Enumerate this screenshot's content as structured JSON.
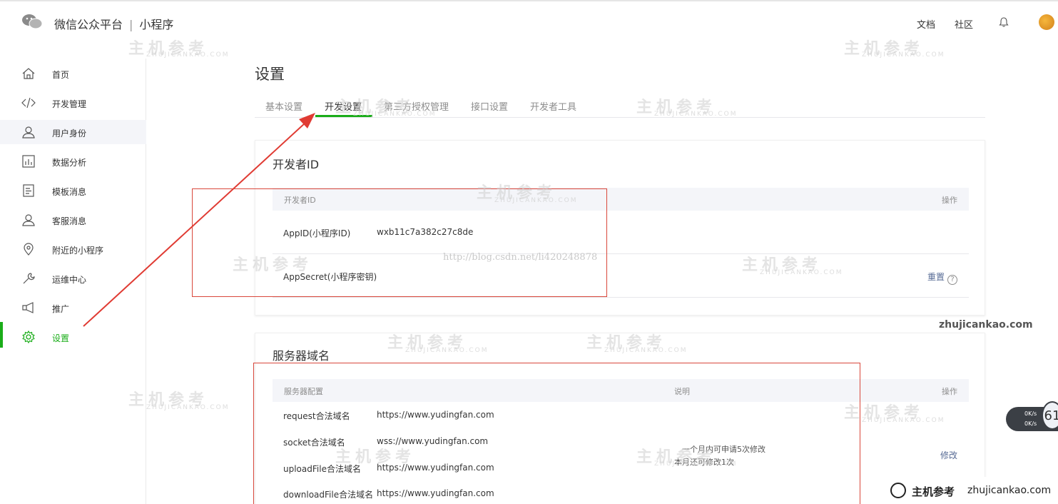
{
  "topbar": {
    "title": "微信公众平台",
    "separator": "|",
    "subtitle": "小程序",
    "links": [
      "文档",
      "社区"
    ]
  },
  "sidebar": {
    "items": [
      {
        "label": "首页",
        "icon": "home-icon"
      },
      {
        "label": "开发管理",
        "icon": "code-icon"
      },
      {
        "label": "用户身份",
        "icon": "user-icon"
      },
      {
        "label": "数据分析",
        "icon": "chart-icon"
      },
      {
        "label": "模板消息",
        "icon": "template-icon"
      },
      {
        "label": "客服消息",
        "icon": "support-icon"
      },
      {
        "label": "附近的小程序",
        "icon": "location-icon"
      },
      {
        "label": "运维中心",
        "icon": "wrench-icon"
      },
      {
        "label": "推广",
        "icon": "megaphone-icon"
      },
      {
        "label": "设置",
        "icon": "gear-icon"
      }
    ],
    "active_item": "设置"
  },
  "main": {
    "title": "设置",
    "tabs": [
      "基本设置",
      "开发设置",
      "第三方授权管理",
      "接口设置",
      "开发者工具"
    ],
    "active_tab": "开发设置",
    "developer_id": {
      "title": "开发者ID",
      "header": {
        "col1": "开发者ID",
        "col2": "操作"
      },
      "rows": [
        {
          "label": "AppID(小程序ID)",
          "value": "wxb11c7a382c27c8de",
          "action": ""
        },
        {
          "label": "AppSecret(小程序密钥)",
          "value": "",
          "action": "重置",
          "help": "?"
        }
      ]
    },
    "server_domain": {
      "title": "服务器域名",
      "header": {
        "col1": "服务器配置",
        "col2": "说明",
        "col3": "操作"
      },
      "rows": [
        {
          "label": "request合法域名",
          "value": "https://www.yudingfan.com"
        },
        {
          "label": "socket合法域名",
          "value": "wss://www.yudingfan.com"
        },
        {
          "label": "uploadFile合法域名",
          "value": "https://www.yudingfan.com"
        },
        {
          "label": "downloadFile合法域名",
          "value": "https://www.yudingfan.com"
        }
      ],
      "note_line1": "一个月内可申请5次修改",
      "note_line2": "本月还可修改1次",
      "action": "修改"
    }
  },
  "watermarks": {
    "brand": "主机参考",
    "sub": "ZHUJICANKAO.COM",
    "url": "http://blog.csdn.net/li420248878",
    "site": "zhujicankao.com",
    "footer_brand": "主机参考",
    "footer_domain": "zhujicankao.com"
  },
  "speed_widget": {
    "up": "0K/s",
    "down": "0K/s",
    "number": "61"
  },
  "colors": {
    "accent": "#1aad19",
    "link": "#576b95",
    "annotation": "#d9473b"
  }
}
